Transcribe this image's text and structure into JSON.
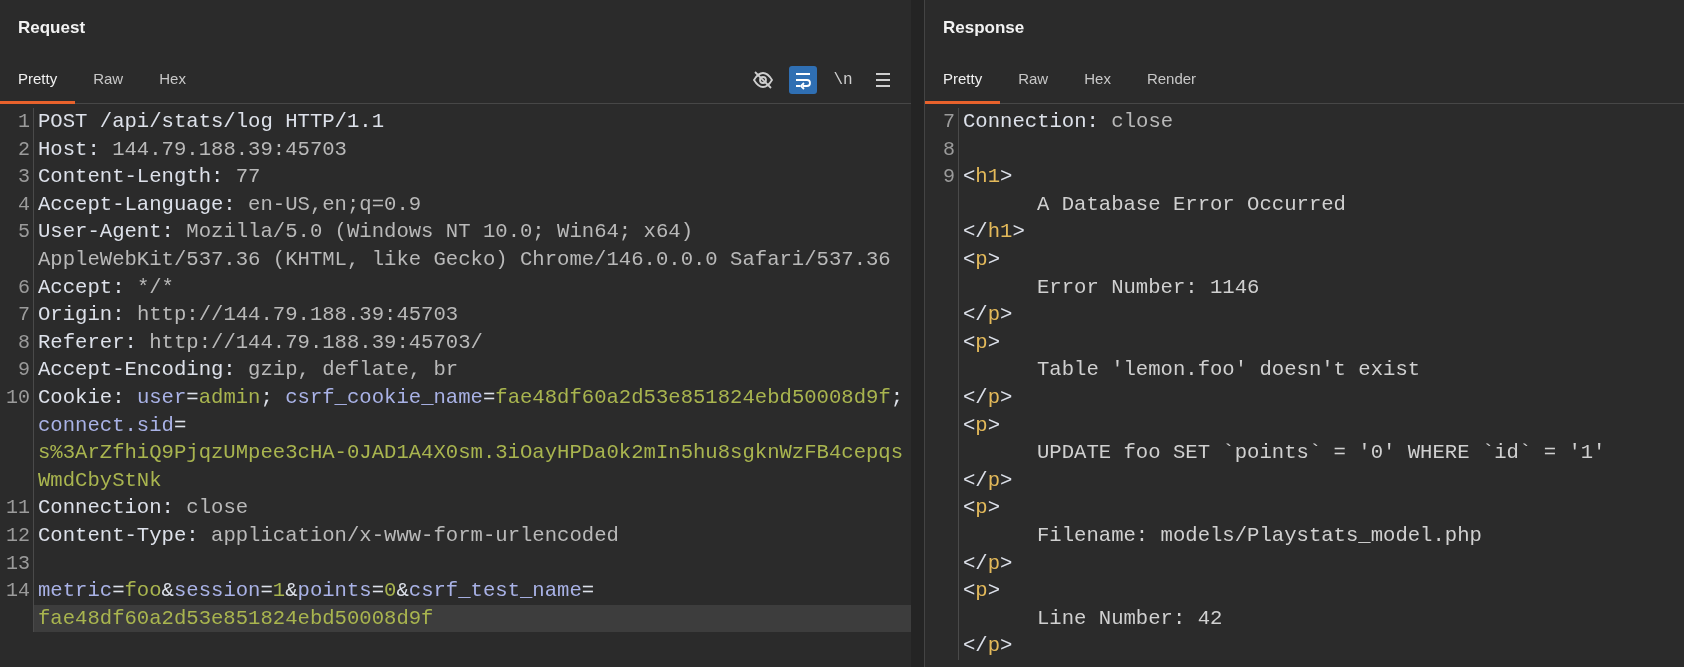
{
  "panels": [
    {
      "title": "Request",
      "tabs": [
        {
          "label": "Pretty",
          "selected": true
        },
        {
          "label": "Raw",
          "selected": false
        },
        {
          "label": "Hex",
          "selected": false
        }
      ],
      "toolbar": [
        {
          "kind": "eye-off",
          "active": false
        },
        {
          "kind": "wrap",
          "active": true
        },
        {
          "kind": "text",
          "label": "\\n",
          "active": false
        },
        {
          "kind": "menu",
          "active": false
        }
      ],
      "rows": [
        {
          "number": "1",
          "highlighted": false,
          "segments": [
            {
              "kind": "name",
              "text": "POST /api/stats/log HTTP/1.1"
            }
          ]
        },
        {
          "number": "2",
          "highlighted": false,
          "segments": [
            {
              "kind": "name",
              "text": "Host: "
            },
            {
              "kind": "value",
              "text": "144.79.188.39:45703"
            }
          ]
        },
        {
          "number": "3",
          "highlighted": false,
          "segments": [
            {
              "kind": "name",
              "text": "Content-Length: "
            },
            {
              "kind": "value",
              "text": "77"
            }
          ]
        },
        {
          "number": "4",
          "highlighted": false,
          "segments": [
            {
              "kind": "name",
              "text": "Accept-Language: "
            },
            {
              "kind": "value",
              "text": "en-US,en;q=0.9"
            }
          ]
        },
        {
          "number": "5",
          "highlighted": false,
          "segments": [
            {
              "kind": "name",
              "text": "User-Agent: "
            },
            {
              "kind": "value",
              "text": "Mozilla/5.0 (Windows NT 10.0; Win64; x64)"
            }
          ]
        },
        {
          "highlighted": false,
          "segments": [
            {
              "kind": "value",
              "text": "AppleWebKit/537.36 (KHTML, like Gecko) Chrome/146.0.0.0 Safari/537.36"
            }
          ]
        },
        {
          "number": "6",
          "highlighted": false,
          "segments": [
            {
              "kind": "name",
              "text": "Accept: "
            },
            {
              "kind": "value",
              "text": "*/*"
            }
          ]
        },
        {
          "number": "7",
          "highlighted": false,
          "segments": [
            {
              "kind": "name",
              "text": "Origin: "
            },
            {
              "kind": "value",
              "text": "http://144.79.188.39:45703"
            }
          ]
        },
        {
          "number": "8",
          "highlighted": false,
          "segments": [
            {
              "kind": "name",
              "text": "Referer: "
            },
            {
              "kind": "value",
              "text": "http://144.79.188.39:45703/"
            }
          ]
        },
        {
          "number": "9",
          "highlighted": false,
          "segments": [
            {
              "kind": "name",
              "text": "Accept-Encoding: "
            },
            {
              "kind": "value",
              "text": "gzip, deflate, br"
            }
          ]
        },
        {
          "number": "10",
          "highlighted": false,
          "segments": [
            {
              "kind": "name",
              "text": "Cookie: "
            },
            {
              "kind": "key",
              "text": "user"
            },
            {
              "kind": "punct",
              "text": "="
            },
            {
              "kind": "val",
              "text": "admin"
            },
            {
              "kind": "punct",
              "text": "; "
            },
            {
              "kind": "key",
              "text": "csrf_cookie_name"
            },
            {
              "kind": "punct",
              "text": "="
            },
            {
              "kind": "val",
              "text": "fae48df60a2d53e851824ebd50008d9f"
            },
            {
              "kind": "punct",
              "text": ";"
            }
          ]
        },
        {
          "highlighted": false,
          "segments": [
            {
              "kind": "key",
              "text": "connect.sid"
            },
            {
              "kind": "punct",
              "text": "="
            }
          ]
        },
        {
          "highlighted": false,
          "segments": [
            {
              "kind": "val",
              "text": "s%3ArZfhiQ9PjqzUMpee3cHA-0JAD1A4X0sm.3iOayHPDa0k2mIn5hu8sgknWzFB4cepqs"
            }
          ]
        },
        {
          "highlighted": false,
          "segments": [
            {
              "kind": "val",
              "text": "WmdCbyStNk"
            }
          ]
        },
        {
          "number": "11",
          "highlighted": false,
          "segments": [
            {
              "kind": "name",
              "text": "Connection: "
            },
            {
              "kind": "value",
              "text": "close"
            }
          ]
        },
        {
          "number": "12",
          "highlighted": false,
          "segments": [
            {
              "kind": "name",
              "text": "Content-Type: "
            },
            {
              "kind": "value",
              "text": "application/x-www-form-urlencoded"
            }
          ]
        },
        {
          "number": "13",
          "highlighted": false,
          "segments": []
        },
        {
          "number": "14",
          "highlighted": false,
          "segments": [
            {
              "kind": "key",
              "text": "metric"
            },
            {
              "kind": "punct",
              "text": "="
            },
            {
              "kind": "val",
              "text": "foo"
            },
            {
              "kind": "punct",
              "text": "&"
            },
            {
              "kind": "key",
              "text": "session"
            },
            {
              "kind": "punct",
              "text": "="
            },
            {
              "kind": "val",
              "text": "1"
            },
            {
              "kind": "punct",
              "text": "&"
            },
            {
              "kind": "key",
              "text": "points"
            },
            {
              "kind": "punct",
              "text": "="
            },
            {
              "kind": "val",
              "text": "0"
            },
            {
              "kind": "punct",
              "text": "&"
            },
            {
              "kind": "key",
              "text": "csrf_test_name"
            },
            {
              "kind": "punct",
              "text": "="
            }
          ]
        },
        {
          "highlighted": true,
          "segments": [
            {
              "kind": "val",
              "text": "fae48df60a2d53e851824ebd50008d9f"
            }
          ]
        }
      ]
    },
    {
      "title": "Response",
      "tabs": [
        {
          "label": "Pretty",
          "selected": true
        },
        {
          "label": "Raw",
          "selected": false
        },
        {
          "label": "Hex",
          "selected": false
        },
        {
          "label": "Render",
          "selected": false
        }
      ],
      "rows": [
        {
          "number": "7",
          "highlighted": false,
          "segments": [
            {
              "kind": "name",
              "text": "Connection: "
            },
            {
              "kind": "value",
              "text": "close"
            }
          ]
        },
        {
          "number": "8",
          "highlighted": false,
          "segments": []
        },
        {
          "number": "9",
          "highlighted": false,
          "segments": [
            {
              "kind": "punct",
              "text": "<"
            },
            {
              "kind": "tag",
              "text": "h1"
            },
            {
              "kind": "punct",
              "text": ">"
            }
          ]
        },
        {
          "highlighted": false,
          "segments": [
            {
              "kind": "content",
              "text": "A Database Error Occurred"
            }
          ]
        },
        {
          "highlighted": false,
          "segments": [
            {
              "kind": "punct",
              "text": "</"
            },
            {
              "kind": "tag",
              "text": "h1"
            },
            {
              "kind": "punct",
              "text": ">"
            }
          ]
        },
        {
          "highlighted": false,
          "segments": [
            {
              "kind": "punct",
              "text": "<"
            },
            {
              "kind": "tag",
              "text": "p"
            },
            {
              "kind": "punct",
              "text": ">"
            }
          ]
        },
        {
          "highlighted": false,
          "segments": [
            {
              "kind": "content",
              "text": "Error Number: 1146"
            }
          ]
        },
        {
          "highlighted": false,
          "segments": [
            {
              "kind": "punct",
              "text": "</"
            },
            {
              "kind": "tag",
              "text": "p"
            },
            {
              "kind": "punct",
              "text": ">"
            }
          ]
        },
        {
          "highlighted": false,
          "segments": [
            {
              "kind": "punct",
              "text": "<"
            },
            {
              "kind": "tag",
              "text": "p"
            },
            {
              "kind": "punct",
              "text": ">"
            }
          ]
        },
        {
          "highlighted": false,
          "segments": [
            {
              "kind": "content",
              "text": "Table 'lemon.foo' doesn't exist"
            }
          ]
        },
        {
          "highlighted": false,
          "segments": [
            {
              "kind": "punct",
              "text": "</"
            },
            {
              "kind": "tag",
              "text": "p"
            },
            {
              "kind": "punct",
              "text": ">"
            }
          ]
        },
        {
          "highlighted": false,
          "segments": [
            {
              "kind": "punct",
              "text": "<"
            },
            {
              "kind": "tag",
              "text": "p"
            },
            {
              "kind": "punct",
              "text": ">"
            }
          ]
        },
        {
          "highlighted": false,
          "segments": [
            {
              "kind": "content",
              "text": "UPDATE foo SET `points` = '0' WHERE `id` = '1'"
            }
          ]
        },
        {
          "highlighted": false,
          "segments": [
            {
              "kind": "punct",
              "text": "</"
            },
            {
              "kind": "tag",
              "text": "p"
            },
            {
              "kind": "punct",
              "text": ">"
            }
          ]
        },
        {
          "highlighted": false,
          "segments": [
            {
              "kind": "punct",
              "text": "<"
            },
            {
              "kind": "tag",
              "text": "p"
            },
            {
              "kind": "punct",
              "text": ">"
            }
          ]
        },
        {
          "highlighted": false,
          "segments": [
            {
              "kind": "content",
              "text": "Filename: models/Playstats_model.php"
            }
          ]
        },
        {
          "highlighted": false,
          "segments": [
            {
              "kind": "punct",
              "text": "</"
            },
            {
              "kind": "tag",
              "text": "p"
            },
            {
              "kind": "punct",
              "text": ">"
            }
          ]
        },
        {
          "highlighted": false,
          "segments": [
            {
              "kind": "punct",
              "text": "<"
            },
            {
              "kind": "tag",
              "text": "p"
            },
            {
              "kind": "punct",
              "text": ">"
            }
          ]
        },
        {
          "highlighted": false,
          "segments": [
            {
              "kind": "content",
              "text": "Line Number: 42"
            }
          ]
        },
        {
          "highlighted": false,
          "segments": [
            {
              "kind": "punct",
              "text": "</"
            },
            {
              "kind": "tag",
              "text": "p"
            },
            {
              "kind": "punct",
              "text": ">"
            }
          ]
        }
      ]
    }
  ]
}
